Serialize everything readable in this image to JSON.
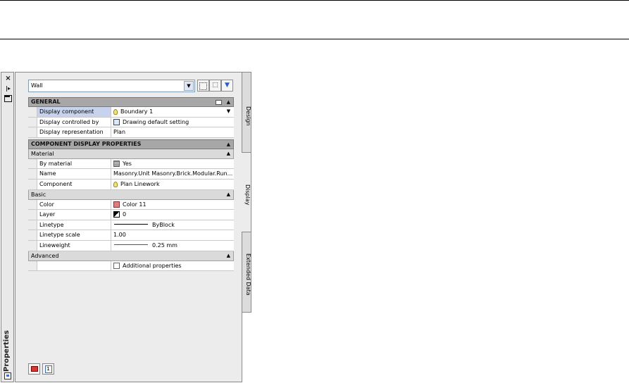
{
  "palette": {
    "title": "Properties",
    "selector_value": "Wall",
    "tabs": [
      "Design",
      "Display",
      "Extended Data"
    ],
    "general": {
      "header": "GENERAL",
      "rows": [
        {
          "label": "Display component",
          "value": "Boundary 1",
          "icon": "bulb-icon"
        },
        {
          "label": "Display controlled by",
          "value": "Drawing default setting",
          "icon": "drawing-icon"
        },
        {
          "label": "Display representation",
          "value": "Plan",
          "icon": ""
        }
      ]
    },
    "component_display": {
      "header": "COMPONENT DISPLAY PROPERTIES",
      "material": {
        "header": "Material",
        "rows": [
          {
            "label": "By material",
            "value": "Yes",
            "icon": "material-stack-icon"
          },
          {
            "label": "Name",
            "value": "Masonry.Unit Masonry.Brick.Modular.Run...",
            "icon": ""
          },
          {
            "label": "Component",
            "value": "Plan Linework",
            "icon": "bulb-icon"
          }
        ]
      },
      "basic": {
        "header": "Basic",
        "rows": [
          {
            "label": "Color",
            "value": "Color 11",
            "icon": "color-swatch-icon",
            "color": "#e37b7b"
          },
          {
            "label": "Layer",
            "value": "0",
            "icon": "layer-icon"
          },
          {
            "label": "Linetype",
            "value": "ByBlock",
            "icon": "linetype-icon"
          },
          {
            "label": "Linetype scale",
            "value": "1.00",
            "icon": ""
          },
          {
            "label": "Lineweight",
            "value": "0.25 mm",
            "icon": "lineweight-icon"
          }
        ]
      },
      "advanced": {
        "header": "Advanced",
        "rows": [
          {
            "label": "",
            "value": "Additional properties",
            "icon": "page-icon"
          }
        ]
      }
    },
    "bottom_buttons": [
      "edit-style-icon",
      "info-icon"
    ],
    "info_button_label": "1"
  }
}
